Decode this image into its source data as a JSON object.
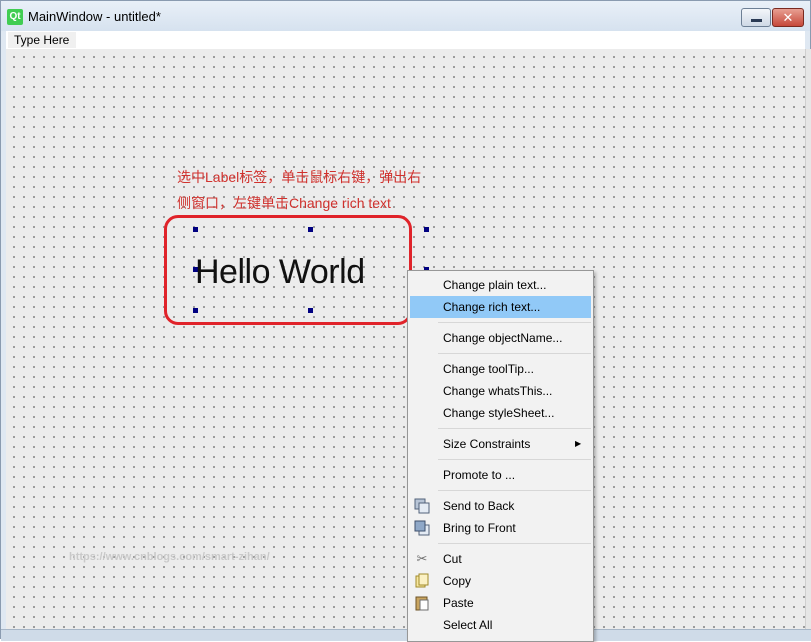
{
  "window": {
    "title": "MainWindow - untitled*",
    "app_icon_text": "Qt",
    "close_glyph": "✕"
  },
  "menubar": {
    "type_here": "Type Here"
  },
  "annotation": {
    "line1": "选中Label标签，单击鼠标右键，弹出右",
    "line2": "侧窗口，左键单击Change rich text"
  },
  "label_widget": {
    "text": "Hello World"
  },
  "watermark": "https://www.cnblogs.com/smart-zihan/",
  "context_menu": {
    "items": [
      {
        "label": "Change plain text..."
      },
      {
        "label": "Change rich text...",
        "highlighted": true
      },
      {
        "label": "Change objectName..."
      },
      {
        "label": "Change toolTip..."
      },
      {
        "label": "Change whatsThis..."
      },
      {
        "label": "Change styleSheet..."
      },
      {
        "label": "Size Constraints",
        "submenu_arrow": "▶"
      },
      {
        "label": "Promote to ..."
      },
      {
        "label": "Send to Back",
        "icon": "send-to-back-icon"
      },
      {
        "label": "Bring to Front",
        "icon": "bring-to-front-icon"
      },
      {
        "label": "Cut",
        "icon": "scissors-icon"
      },
      {
        "label": "Copy",
        "icon": "copy-icon"
      },
      {
        "label": "Paste",
        "icon": "paste-icon"
      },
      {
        "label": "Select All"
      }
    ]
  },
  "colors": {
    "annotation_red": "#d0312d",
    "highlight_box_red": "#e0232a",
    "menu_highlight": "#91c9f7",
    "selection_handle": "#000080"
  }
}
